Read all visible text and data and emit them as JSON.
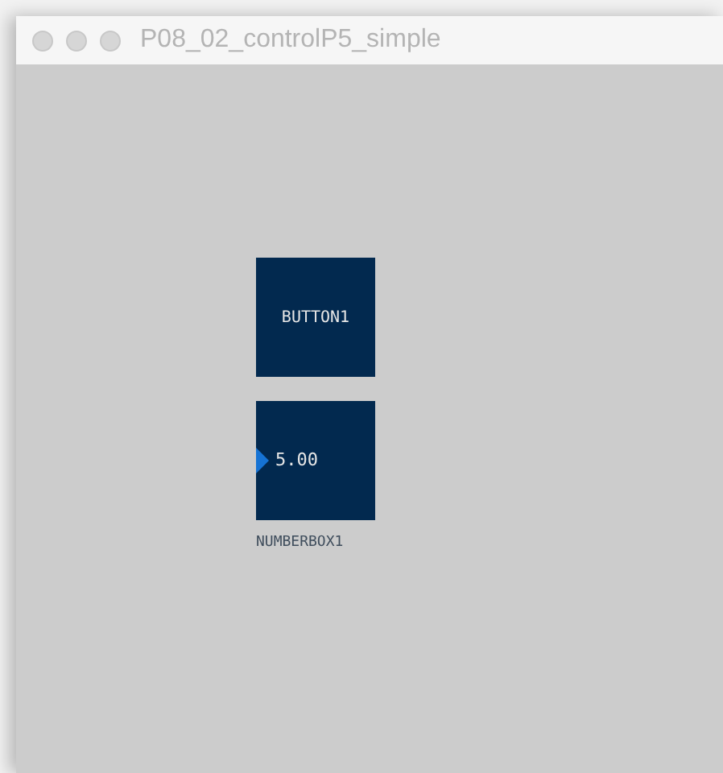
{
  "window": {
    "title": "P08_02_controlP5_simple"
  },
  "button": {
    "label": "BUTTON1"
  },
  "numberbox": {
    "value": "5.00",
    "label": "NUMBERBOX1"
  }
}
